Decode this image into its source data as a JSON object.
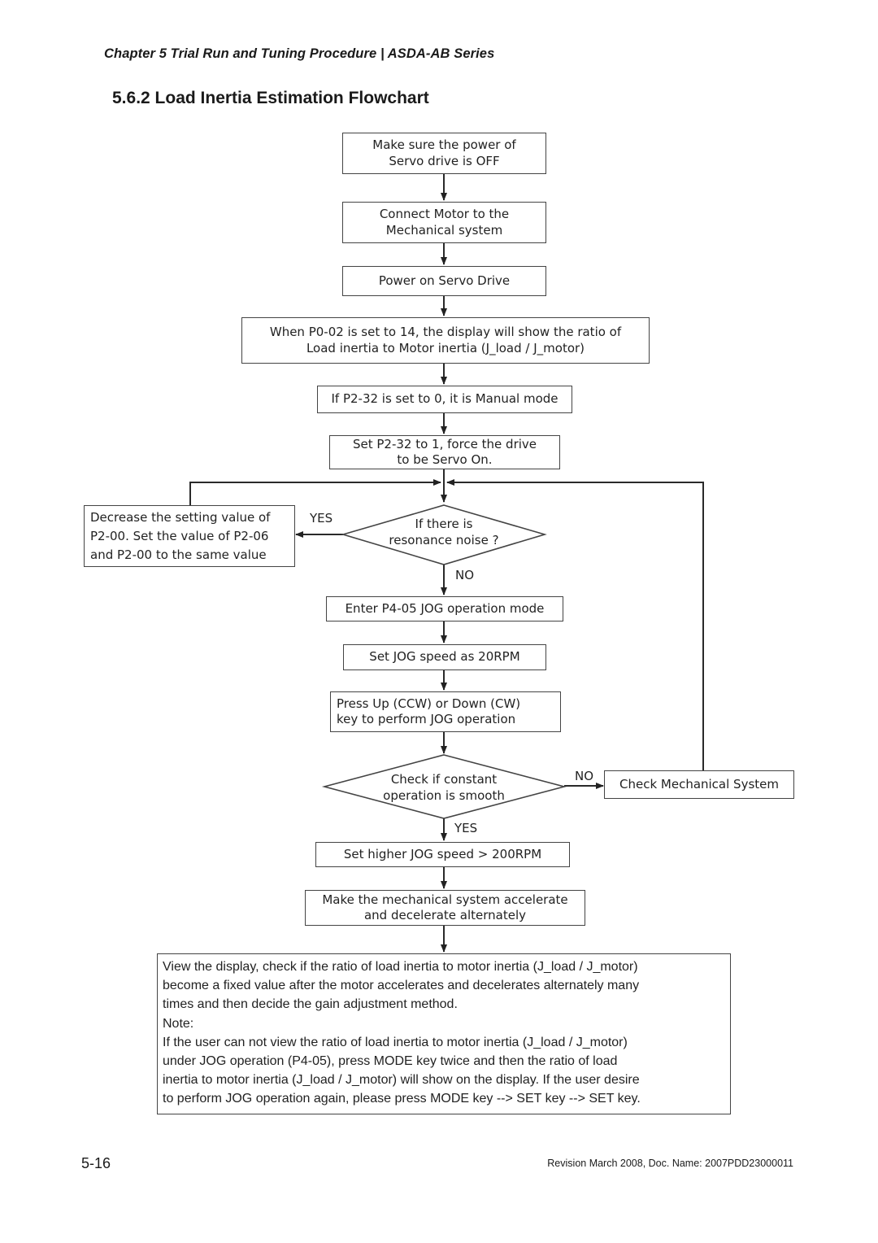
{
  "header": {
    "chapter": "Chapter 5  Trial Run and Tuning Procedure | ASDA-AB Series"
  },
  "section_title": "5.6.2  Load Inertia Estimation Flowchart",
  "flowchart": {
    "steps": [
      {
        "id": "power-off",
        "lines": [
          "Make sure the power of",
          "Servo drive is OFF"
        ]
      },
      {
        "id": "connect-motor",
        "lines": [
          "Connect Motor to the",
          "Mechanical system"
        ]
      },
      {
        "id": "power-on",
        "lines": [
          "Power on Servo Drive"
        ]
      },
      {
        "id": "set-p0-02",
        "lines": [
          "When P0-02 is set to 14, the display will show the ratio of",
          "Load inertia to Motor inertia (J_load / J_motor)"
        ]
      },
      {
        "id": "p2-32-manual",
        "lines": [
          "If P2-32 is set to 0, it is Manual mode"
        ]
      },
      {
        "id": "set-p2-32",
        "lines": [
          "Set P2-32 to 1, force the drive",
          "to be Servo On."
        ]
      },
      {
        "id": "decrease-p2-00",
        "lines": [
          "Decrease the setting value of",
          "P2-00. Set the value of P2-06",
          "and P2-00 to the same value"
        ]
      },
      {
        "id": "enter-jog",
        "lines": [
          "Enter P4-05 JOG operation mode"
        ]
      },
      {
        "id": "jog-20rpm",
        "lines": [
          "Set JOG speed as 20RPM"
        ]
      },
      {
        "id": "press-up-down",
        "lines": [
          "Press Up (CCW) or Down (CW)",
          "key to perform JOG operation"
        ]
      },
      {
        "id": "check-mechanical",
        "lines": [
          "Check Mechanical System"
        ]
      },
      {
        "id": "jog-200rpm",
        "lines": [
          "Set higher JOG speed > 200RPM"
        ]
      },
      {
        "id": "accel-decel",
        "lines": [
          "Make the mechanical system accelerate",
          "and decelerate alternately"
        ]
      }
    ],
    "decisions": [
      {
        "id": "resonance",
        "lines": [
          "If there is",
          "resonance noise ?"
        ],
        "yes_label": "YES",
        "no_label": "NO"
      },
      {
        "id": "smooth",
        "lines": [
          "Check if constant",
          "operation is smooth"
        ],
        "yes_label": "YES",
        "no_label": "NO"
      }
    ],
    "final_note": {
      "lines": [
        "View the display, check if the ratio of load inertia to motor inertia (J_load / J_motor)",
        "become a fixed value after the motor accelerates and decelerates alternately many",
        "times and then decide the gain adjustment method.",
        "Note:",
        "If the user can not view the ratio of load inertia to motor inertia (J_load / J_motor)",
        "under JOG operation (P4-05), press MODE key twice and then the ratio of load",
        "inertia to motor inertia (J_load / J_motor) will show on the display. If the user desire",
        "to perform JOG operation again, please press MODE key --> SET key --> SET key."
      ]
    }
  },
  "footer": {
    "page_number": "5-16",
    "revision": "Revision March 2008, Doc. Name: 2007PDD23000011"
  }
}
